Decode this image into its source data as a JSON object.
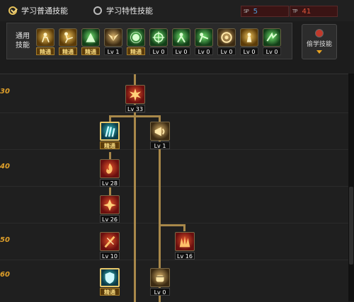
{
  "modes": [
    {
      "label": "学习普通技能",
      "checked": true
    },
    {
      "label": "学习特性技能",
      "checked": false
    }
  ],
  "points": [
    {
      "tag": "SP",
      "value": "5",
      "color": "#4fa3e0"
    },
    {
      "tag": "TP",
      "value": "41",
      "color": "#e0553a"
    }
  ],
  "common": {
    "label": "通用技能",
    "skills": [
      {
        "label": "精通",
        "master": true,
        "icon": "sit-icon",
        "tone": "goldy"
      },
      {
        "label": "精通",
        "master": true,
        "icon": "kick-icon",
        "tone": "goldy"
      },
      {
        "label": "精通",
        "master": true,
        "icon": "strike-icon",
        "tone": "green"
      },
      {
        "label": "Lv 1",
        "master": false,
        "icon": "wings-icon",
        "tone": "gold"
      },
      {
        "label": "精通",
        "master": true,
        "icon": "burst-icon",
        "tone": "green"
      },
      {
        "label": "Lv 0",
        "master": false,
        "icon": "crosshair-icon",
        "tone": "green"
      },
      {
        "label": "Lv 0",
        "master": false,
        "icon": "fighter-icon",
        "tone": "green"
      },
      {
        "label": "Lv 0",
        "master": false,
        "icon": "grapple-icon",
        "tone": "green"
      },
      {
        "label": "Lv 0",
        "master": false,
        "icon": "ring-icon",
        "tone": "gold"
      },
      {
        "label": "Lv 0",
        "master": false,
        "icon": "statue-icon",
        "tone": "goldy"
      },
      {
        "label": "Lv 0",
        "master": false,
        "icon": "dash-icon",
        "tone": "green"
      }
    ]
  },
  "steal_button": {
    "label": "偷学技能"
  },
  "level_rows": [
    {
      "label": "30"
    },
    {
      "label": ""
    },
    {
      "label": "40"
    },
    {
      "label": ""
    },
    {
      "label": "50"
    },
    {
      "label": "60"
    }
  ],
  "tree_nodes": [
    {
      "label": "Lv 33",
      "master": false,
      "icon": "explosion-icon",
      "tone": "red",
      "selected": false
    },
    {
      "label": "精通",
      "master": true,
      "icon": "claw-icon",
      "tone": "teal",
      "selected": true
    },
    {
      "label": "Lv 1",
      "master": false,
      "icon": "horn-icon",
      "tone": "gold",
      "selected": false
    },
    {
      "label": "Lv 28",
      "master": false,
      "icon": "flame-fist-icon",
      "tone": "red",
      "selected": false
    },
    {
      "label": "Lv 26",
      "master": false,
      "icon": "blast-icon",
      "tone": "red",
      "selected": false
    },
    {
      "label": "Lv 10",
      "master": false,
      "icon": "slash-icon",
      "tone": "red",
      "selected": false
    },
    {
      "label": "Lv 16",
      "master": false,
      "icon": "spike-icon",
      "tone": "red",
      "selected": false
    },
    {
      "label": "精通",
      "master": true,
      "icon": "shield-icon",
      "tone": "teal",
      "selected": true
    },
    {
      "label": "Lv 0",
      "master": false,
      "icon": "fist-icon",
      "tone": "gold",
      "selected": false
    }
  ]
}
